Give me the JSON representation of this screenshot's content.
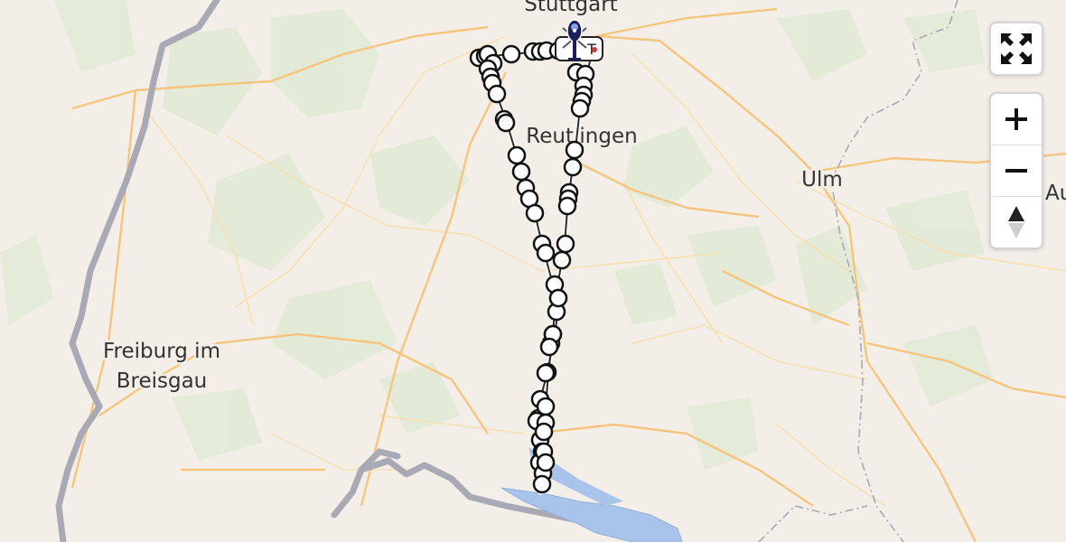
{
  "map": {
    "city_labels": [
      {
        "id": "stuttgart",
        "text": "Stuttgart"
      },
      {
        "id": "reutlingen",
        "text": "Reutlingen"
      },
      {
        "id": "ulm",
        "text": "Ulm"
      },
      {
        "id": "augsburg-partial",
        "text": "Au"
      },
      {
        "id": "freiburg-line1",
        "text": "Freiburg im"
      },
      {
        "id": "freiburg-line2",
        "text": "Breisgau"
      }
    ],
    "colors": {
      "land": "#f3efe8",
      "forest": "#e2e9d6",
      "water": "#a9c4ea",
      "road_major": "#f6c57d",
      "border": "#a8a8b4",
      "route": "#2b2b2b",
      "marker_fill": "#ffffff",
      "helicopter": "#1b1f5a"
    },
    "start_badge": "T",
    "controls": {
      "fullscreen": "fullscreen-icon",
      "zoom_in": "plus-icon",
      "zoom_out": "minus-icon",
      "compass": "compass-icon"
    }
  }
}
